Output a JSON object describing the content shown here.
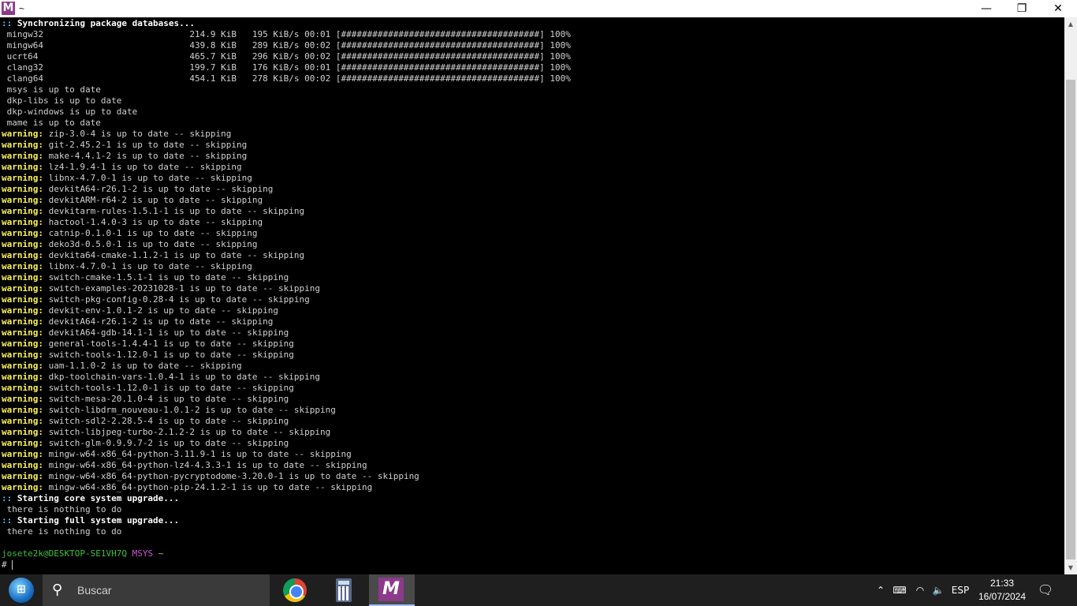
{
  "window": {
    "title": "~",
    "app_icon_letter": "M",
    "minimize_label": "—",
    "restore_label": "❐",
    "close_label": "✕"
  },
  "colors": {
    "warning": "#fdf35b",
    "prefix": "#57c7ff",
    "user": "#3ec13e",
    "msys": "#c957d4",
    "path": "#d8c23a",
    "background": "#000000"
  },
  "terminal": {
    "lines": [
      {
        "prefix": "::",
        "prefix_style": "cyan",
        "text": " Synchronizing package databases...",
        "text_style": "bold"
      },
      {
        "text": " mingw32                            214.9 KiB   195 KiB/s 00:01 [######################################] 100%"
      },
      {
        "text": " mingw64                            439.8 KiB   289 KiB/s 00:02 [######################################] 100%"
      },
      {
        "text": " ucrt64                             465.7 KiB   296 KiB/s 00:02 [######################################] 100%"
      },
      {
        "text": " clang32                            199.7 KiB   176 KiB/s 00:01 [######################################] 100%"
      },
      {
        "text": " clang64                            454.1 KiB   278 KiB/s 00:02 [######################################] 100%"
      },
      {
        "text": " msys is up to date"
      },
      {
        "text": " dkp-libs is up to date"
      },
      {
        "text": " dkp-windows is up to date"
      },
      {
        "text": " mame is up to date"
      },
      {
        "prefix": "warning:",
        "prefix_style": "warn",
        "text": " zip-3.0-4 is up to date -- skipping"
      },
      {
        "prefix": "warning:",
        "prefix_style": "warn",
        "text": " git-2.45.2-1 is up to date -- skipping"
      },
      {
        "prefix": "warning:",
        "prefix_style": "warn",
        "text": " make-4.4.1-2 is up to date -- skipping"
      },
      {
        "prefix": "warning:",
        "prefix_style": "warn",
        "text": " lz4-1.9.4-1 is up to date -- skipping"
      },
      {
        "prefix": "warning:",
        "prefix_style": "warn",
        "text": " libnx-4.7.0-1 is up to date -- skipping"
      },
      {
        "prefix": "warning:",
        "prefix_style": "warn",
        "text": " devkitA64-r26.1-2 is up to date -- skipping"
      },
      {
        "prefix": "warning:",
        "prefix_style": "warn",
        "text": " devkitARM-r64-2 is up to date -- skipping"
      },
      {
        "prefix": "warning:",
        "prefix_style": "warn",
        "text": " devkitarm-rules-1.5.1-1 is up to date -- skipping"
      },
      {
        "prefix": "warning:",
        "prefix_style": "warn",
        "text": " hactool-1.4.0-3 is up to date -- skipping"
      },
      {
        "prefix": "warning:",
        "prefix_style": "warn",
        "text": " catnip-0.1.0-1 is up to date -- skipping"
      },
      {
        "prefix": "warning:",
        "prefix_style": "warn",
        "text": " deko3d-0.5.0-1 is up to date -- skipping"
      },
      {
        "prefix": "warning:",
        "prefix_style": "warn",
        "text": " devkita64-cmake-1.1.2-1 is up to date -- skipping"
      },
      {
        "prefix": "warning:",
        "prefix_style": "warn",
        "text": " libnx-4.7.0-1 is up to date -- skipping"
      },
      {
        "prefix": "warning:",
        "prefix_style": "warn",
        "text": " switch-cmake-1.5.1-1 is up to date -- skipping"
      },
      {
        "prefix": "warning:",
        "prefix_style": "warn",
        "text": " switch-examples-20231028-1 is up to date -- skipping"
      },
      {
        "prefix": "warning:",
        "prefix_style": "warn",
        "text": " switch-pkg-config-0.28-4 is up to date -- skipping"
      },
      {
        "prefix": "warning:",
        "prefix_style": "warn",
        "text": " devkit-env-1.0.1-2 is up to date -- skipping"
      },
      {
        "prefix": "warning:",
        "prefix_style": "warn",
        "text": " devkitA64-r26.1-2 is up to date -- skipping"
      },
      {
        "prefix": "warning:",
        "prefix_style": "warn",
        "text": " devkitA64-gdb-14.1-1 is up to date -- skipping"
      },
      {
        "prefix": "warning:",
        "prefix_style": "warn",
        "text": " general-tools-1.4.4-1 is up to date -- skipping"
      },
      {
        "prefix": "warning:",
        "prefix_style": "warn",
        "text": " switch-tools-1.12.0-1 is up to date -- skipping"
      },
      {
        "prefix": "warning:",
        "prefix_style": "warn",
        "text": " uam-1.1.0-2 is up to date -- skipping"
      },
      {
        "prefix": "warning:",
        "prefix_style": "warn",
        "text": " dkp-toolchain-vars-1.0.4-1 is up to date -- skipping"
      },
      {
        "prefix": "warning:",
        "prefix_style": "warn",
        "text": " switch-tools-1.12.0-1 is up to date -- skipping"
      },
      {
        "prefix": "warning:",
        "prefix_style": "warn",
        "text": " switch-mesa-20.1.0-4 is up to date -- skipping"
      },
      {
        "prefix": "warning:",
        "prefix_style": "warn",
        "text": " switch-libdrm_nouveau-1.0.1-2 is up to date -- skipping"
      },
      {
        "prefix": "warning:",
        "prefix_style": "warn",
        "text": " switch-sdl2-2.28.5-4 is up to date -- skipping"
      },
      {
        "prefix": "warning:",
        "prefix_style": "warn",
        "text": " switch-libjpeg-turbo-2.1.2-2 is up to date -- skipping"
      },
      {
        "prefix": "warning:",
        "prefix_style": "warn",
        "text": " switch-glm-0.9.9.7-2 is up to date -- skipping"
      },
      {
        "prefix": "warning:",
        "prefix_style": "warn",
        "text": " mingw-w64-x86_64-python-3.11.9-1 is up to date -- skipping"
      },
      {
        "prefix": "warning:",
        "prefix_style": "warn",
        "text": " mingw-w64-x86_64-python-lz4-4.3.3-1 is up to date -- skipping"
      },
      {
        "prefix": "warning:",
        "prefix_style": "warn",
        "text": " mingw-w64-x86_64-python-pycryptodome-3.20.0-1 is up to date -- skipping"
      },
      {
        "prefix": "warning:",
        "prefix_style": "warn",
        "text": " mingw-w64-x86_64-python-pip-24.1.2-1 is up to date -- skipping"
      },
      {
        "prefix": "::",
        "prefix_style": "cyan",
        "text": " Starting core system upgrade...",
        "text_style": "bold"
      },
      {
        "text": " there is nothing to do"
      },
      {
        "prefix": "::",
        "prefix_style": "cyan",
        "text": " Starting full system upgrade...",
        "text_style": "bold"
      },
      {
        "text": " there is nothing to do"
      },
      {
        "text": ""
      }
    ],
    "prompt": {
      "user_host": "josete2k@DESKTOP-SE1VH7Q",
      "env": "MSYS",
      "path": "~",
      "symbol": "#"
    }
  },
  "taskbar": {
    "search_placeholder": "Buscar",
    "apps": [
      {
        "name": "chrome"
      },
      {
        "name": "calculator"
      },
      {
        "name": "msys2",
        "letter": "M",
        "active": true
      }
    ],
    "tray": {
      "language": "ESP",
      "time": "21:33",
      "date": "16/07/2024"
    }
  }
}
